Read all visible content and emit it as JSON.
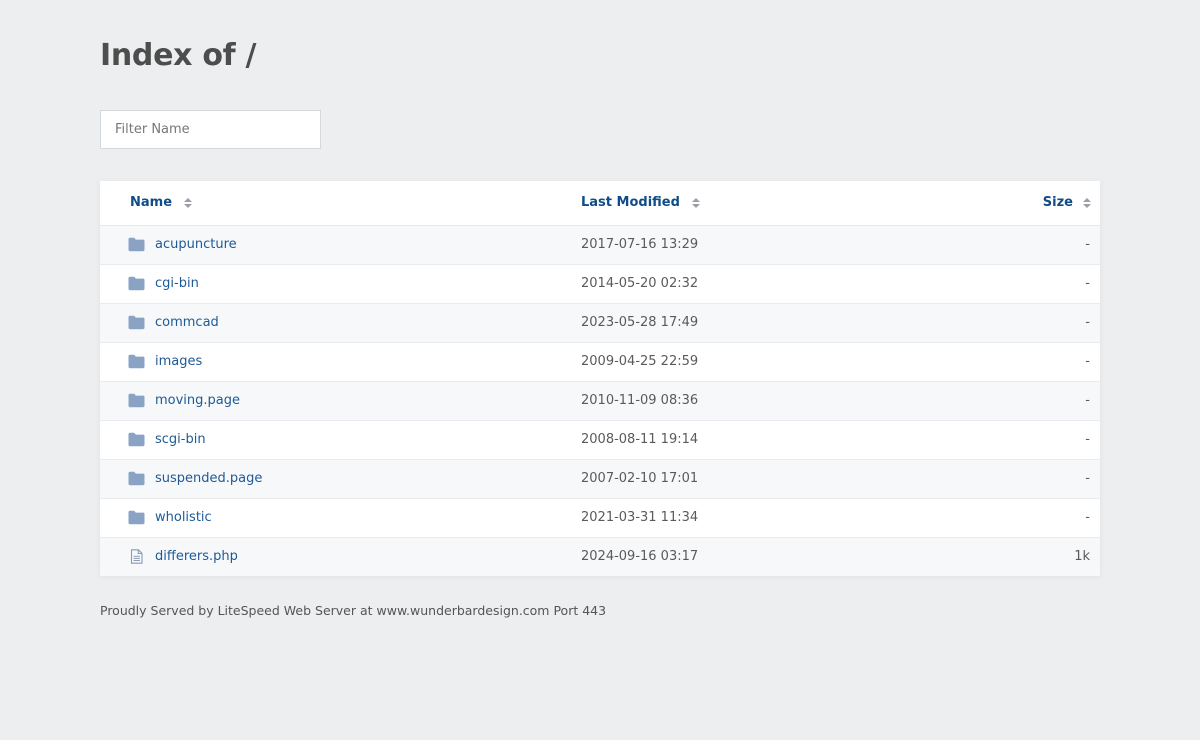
{
  "page": {
    "title": "Index of /"
  },
  "filter": {
    "placeholder": "Filter Name",
    "value": ""
  },
  "columns": {
    "name": "Name",
    "last_modified": "Last Modified",
    "size": "Size"
  },
  "entries": [
    {
      "name": "acupuncture",
      "modified": "2017-07-16 13:29",
      "size": "-",
      "icon": "folder-icon"
    },
    {
      "name": "cgi-bin",
      "modified": "2014-05-20 02:32",
      "size": "-",
      "icon": "folder-icon"
    },
    {
      "name": "commcad",
      "modified": "2023-05-28 17:49",
      "size": "-",
      "icon": "folder-icon"
    },
    {
      "name": "images",
      "modified": "2009-04-25 22:59",
      "size": "-",
      "icon": "folder-icon"
    },
    {
      "name": "moving.page",
      "modified": "2010-11-09 08:36",
      "size": "-",
      "icon": "folder-icon"
    },
    {
      "name": "scgi-bin",
      "modified": "2008-08-11 19:14",
      "size": "-",
      "icon": "folder-icon"
    },
    {
      "name": "suspended.page",
      "modified": "2007-02-10 17:01",
      "size": "-",
      "icon": "folder-icon"
    },
    {
      "name": "wholistic",
      "modified": "2021-03-31 11:34",
      "size": "-",
      "icon": "folder-icon"
    },
    {
      "name": "differers.php",
      "modified": "2024-09-16 03:17",
      "size": "1k",
      "icon": "file-icon"
    }
  ],
  "footer": {
    "text": "Proudly Served by LiteSpeed Web Server at www.wunderbardesign.com Port 443"
  },
  "colors": {
    "background": "#eceef0",
    "link": "#1f5a96",
    "header_link": "#0f4c8a",
    "folder_icon": "#8aa3c4",
    "file_icon": "#8a9bb3"
  }
}
